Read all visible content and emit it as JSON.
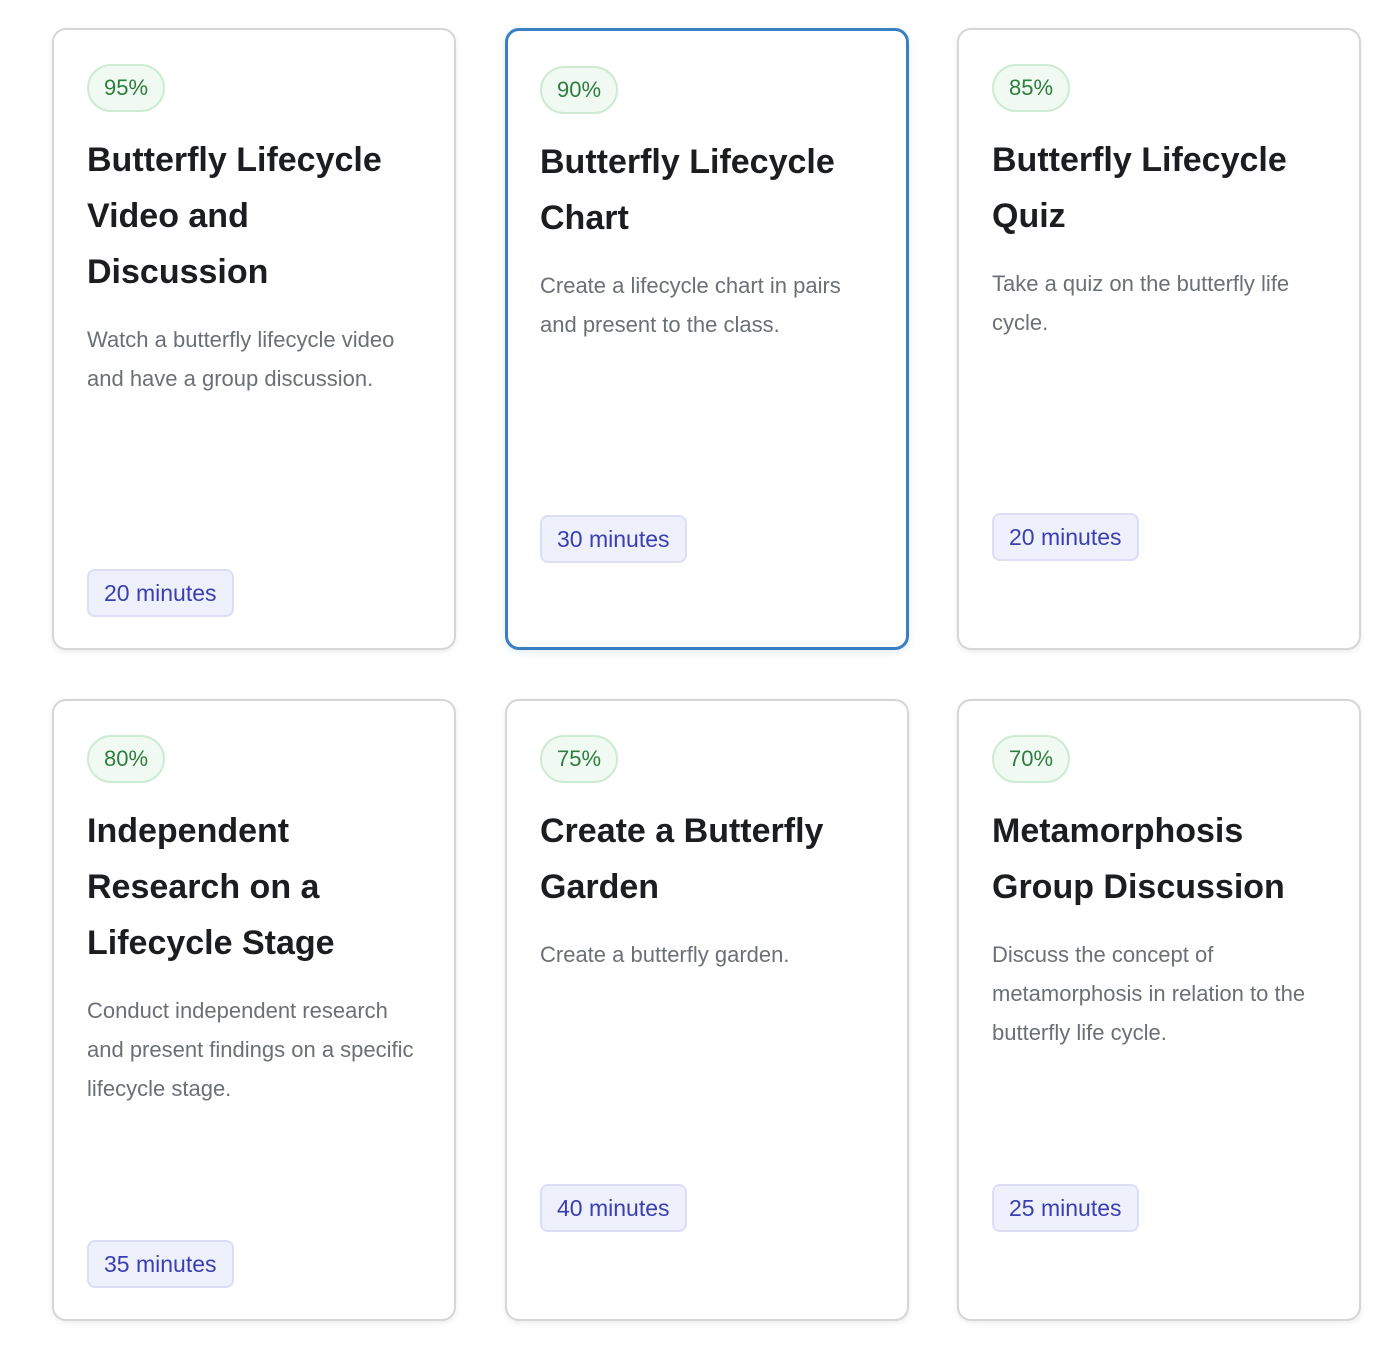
{
  "cards": [
    {
      "score": "95%",
      "title": "Butterfly Lifecycle Video and Discussion",
      "description": "Watch a butterfly lifecycle video and have a group discussion.",
      "duration": "20 minutes",
      "selected": false
    },
    {
      "score": "90%",
      "title": "Butterfly Lifecycle Chart",
      "description": "Create a lifecycle chart in pairs and present to the class.",
      "duration": "30 minutes",
      "selected": true
    },
    {
      "score": "85%",
      "title": "Butterfly Lifecycle Quiz",
      "description": "Take a quiz on the butterfly life cycle.",
      "duration": "20 minutes",
      "selected": false
    },
    {
      "score": "80%",
      "title": "Independent Research on a Lifecycle Stage",
      "description": "Conduct independent research and present findings on a specific lifecycle stage.",
      "duration": "35 minutes",
      "selected": false
    },
    {
      "score": "75%",
      "title": "Create a Butterfly Garden",
      "description": "Create a butterfly garden.",
      "duration": "40 minutes",
      "selected": false
    },
    {
      "score": "70%",
      "title": "Metamorphosis Group Discussion",
      "description": "Discuss the concept of metamorphosis in relation to the butterfly life cycle.",
      "duration": "25 minutes",
      "selected": false
    }
  ],
  "colors": {
    "selected_border": "#3a7fc1",
    "score_text": "#2e7d3f",
    "score_bg": "#f0faf2",
    "duration_text": "#3a3eb0",
    "duration_bg": "#eef0fc"
  }
}
